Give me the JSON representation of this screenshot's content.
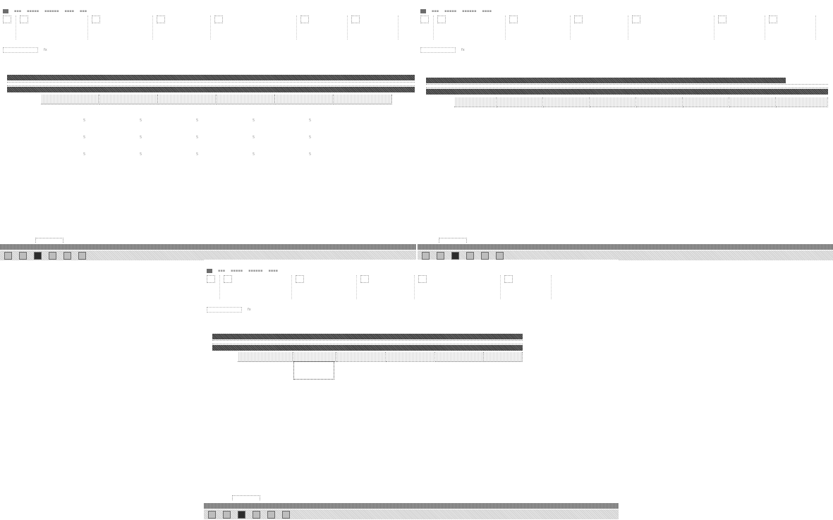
{
  "panes": [
    {
      "id": "left",
      "title": "",
      "header_bar_labels": [
        "",
        "",
        ""
      ],
      "sub_label": "",
      "col_headers": [],
      "rows": [
        {
          "label": "",
          "cells": [
            "5",
            "5",
            "5",
            "5",
            "5",
            ""
          ]
        },
        {
          "label": "",
          "cells": [
            "5",
            "5",
            "5",
            "5",
            "5",
            ""
          ]
        },
        {
          "label": "",
          "cells": [
            "5",
            "5",
            "5",
            "5",
            "5",
            ""
          ]
        }
      ],
      "sheet_tab": ""
    },
    {
      "id": "right",
      "title": "",
      "header_bar_labels": [
        "",
        "",
        ""
      ],
      "sub_label": "",
      "col_headers": [],
      "rows": [
        {
          "label": "",
          "cells": [
            "",
            "",
            "",
            "",
            "",
            "",
            "",
            ""
          ]
        },
        {
          "label": "",
          "cells": [
            "",
            "",
            "",
            "",
            "",
            "",
            "",
            ""
          ]
        },
        {
          "label": "",
          "cells": [
            "",
            "",
            "",
            "",
            "",
            "",
            "",
            ""
          ]
        },
        {
          "label": "",
          "cells": [
            "",
            "",
            "",
            "",
            "",
            "",
            "",
            ""
          ]
        },
        {
          "label": "",
          "cells": [
            "",
            "",
            "",
            "",
            "",
            "",
            "",
            ""
          ]
        },
        {
          "label": "",
          "cells": [
            "",
            "",
            "",
            "",
            "",
            "",
            "",
            ""
          ]
        },
        {
          "label": "",
          "cells": [
            "",
            "",
            "",
            "",
            "",
            "",
            "",
            ""
          ]
        },
        {
          "label": "",
          "cells": [
            "",
            "",
            "",
            "",
            "",
            "",
            "",
            ""
          ]
        }
      ],
      "sheet_tab": ""
    },
    {
      "id": "bottom",
      "title": "",
      "header_bar_labels": [
        "",
        "",
        ""
      ],
      "sub_label": "",
      "col_headers": [],
      "rows": [],
      "sheet_tab": ""
    }
  ],
  "colors": {
    "bar": "#4a4a4a",
    "background": "#ffffff",
    "status": "#8a8a8a"
  },
  "taskbar_icons": [
    "start-icon",
    "ie-icon",
    "explorer-icon",
    "excel-icon",
    "media-icon",
    "folder-icon",
    "window-icon"
  ]
}
